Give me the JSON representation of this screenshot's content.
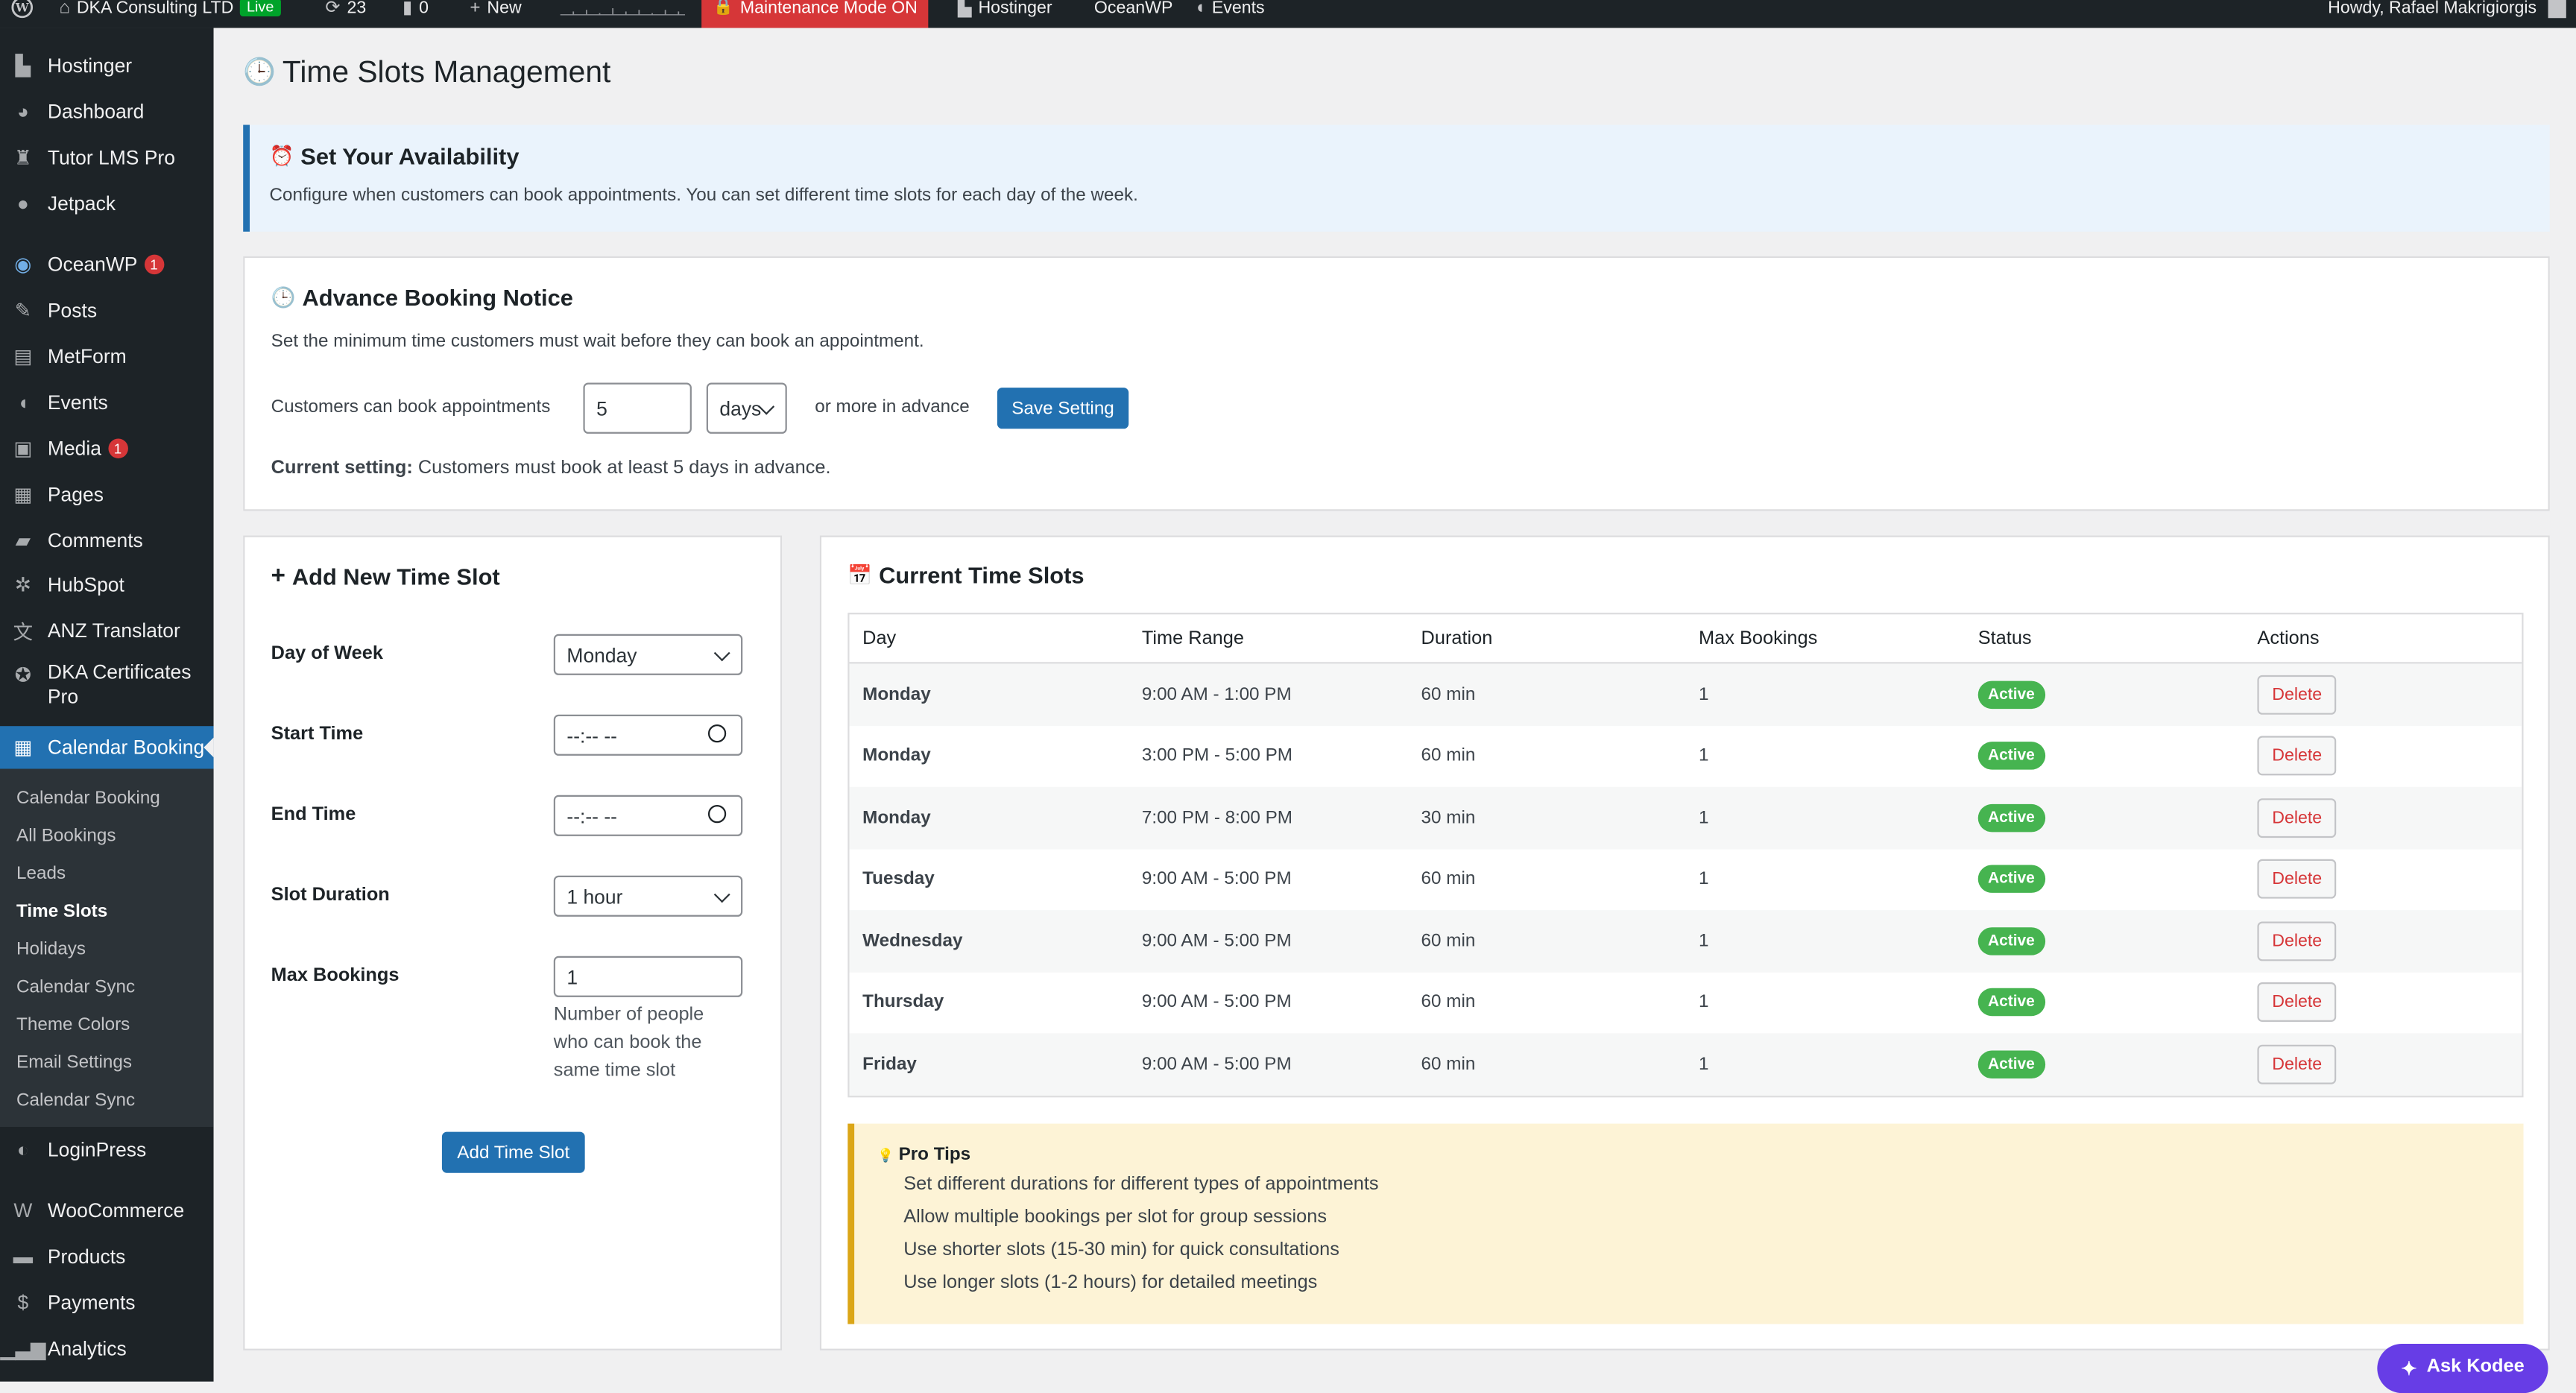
{
  "admin_bar": {
    "site_name": "DKA Consulting LTD",
    "live_badge": "Live",
    "updates_count": "23",
    "comments_count": "0",
    "new_label": "New",
    "maintenance_label": "Maintenance Mode ON",
    "hostinger_label": "Hostinger",
    "oceanwp_label": "OceanWP",
    "events_label": "Events",
    "howdy": "Howdy, Rafael Makrigiorgis"
  },
  "sidebar": {
    "items": [
      {
        "label": "Hostinger",
        "icon": "hostinger-icon"
      },
      {
        "label": "Dashboard",
        "icon": "dashboard-icon"
      },
      {
        "label": "Tutor LMS Pro",
        "icon": "tutor-icon"
      },
      {
        "label": "Jetpack",
        "icon": "jetpack-icon"
      },
      {
        "label": "OceanWP",
        "icon": "oceanwp-icon",
        "badge": "1"
      },
      {
        "label": "Posts",
        "icon": "pin-icon"
      },
      {
        "label": "MetForm",
        "icon": "form-icon"
      },
      {
        "label": "Events",
        "icon": "megaphone-icon"
      },
      {
        "label": "Media",
        "icon": "media-icon",
        "badge": "1"
      },
      {
        "label": "Pages",
        "icon": "pages-icon"
      },
      {
        "label": "Comments",
        "icon": "comment-icon"
      },
      {
        "label": "HubSpot",
        "icon": "hubspot-icon"
      },
      {
        "label": "ANZ Translator",
        "icon": "translate-icon"
      },
      {
        "label": "DKA Certificates Pro",
        "icon": "certificate-icon"
      },
      {
        "label": "Calendar Booking",
        "icon": "calendar-icon"
      },
      {
        "label": "LoginPress",
        "icon": "loginpress-icon"
      },
      {
        "label": "WooCommerce",
        "icon": "woocommerce-icon"
      },
      {
        "label": "Products",
        "icon": "products-icon"
      },
      {
        "label": "Payments",
        "icon": "payments-icon"
      },
      {
        "label": "Analytics",
        "icon": "analytics-icon"
      }
    ],
    "submenu": [
      "Calendar Booking",
      "All Bookings",
      "Leads",
      "Time Slots",
      "Holidays",
      "Calendar Sync",
      "Theme Colors",
      "Email Settings",
      "Calendar Sync"
    ]
  },
  "page": {
    "title": "Time Slots Management"
  },
  "availability": {
    "title": "Set Your Availability",
    "description": "Configure when customers can book appointments. You can set different time slots for each day of the week."
  },
  "advance": {
    "title": "Advance Booking Notice",
    "description": "Set the minimum time customers must wait before they can book an appointment.",
    "label": "Customers can book appointments",
    "value": "5",
    "unit": "days",
    "suffix": "or more in advance",
    "save_label": "Save Setting",
    "current_label": "Current setting:",
    "current_text": "Customers must book at least 5 days in advance."
  },
  "add_slot": {
    "title": "Add New Time Slot",
    "day_label": "Day of Week",
    "day_value": "Monday",
    "start_label": "Start Time",
    "start_value": "--:-- --",
    "end_label": "End Time",
    "end_value": "--:-- --",
    "duration_label": "Slot Duration",
    "duration_value": "1 hour",
    "max_label": "Max Bookings",
    "max_value": "1",
    "max_help": "Number of people who can book the same time slot",
    "submit_label": "Add Time Slot"
  },
  "slots": {
    "title": "Current Time Slots",
    "headers": [
      "Day",
      "Time Range",
      "Duration",
      "Max Bookings",
      "Status",
      "Actions"
    ],
    "rows": [
      {
        "day": "Monday",
        "range": "9:00 AM - 1:00 PM",
        "duration": "60 min",
        "max": "1",
        "status": "Active",
        "action": "Delete"
      },
      {
        "day": "Monday",
        "range": "3:00 PM - 5:00 PM",
        "duration": "60 min",
        "max": "1",
        "status": "Active",
        "action": "Delete"
      },
      {
        "day": "Monday",
        "range": "7:00 PM - 8:00 PM",
        "duration": "30 min",
        "max": "1",
        "status": "Active",
        "action": "Delete"
      },
      {
        "day": "Tuesday",
        "range": "9:00 AM - 5:00 PM",
        "duration": "60 min",
        "max": "1",
        "status": "Active",
        "action": "Delete"
      },
      {
        "day": "Wednesday",
        "range": "9:00 AM - 5:00 PM",
        "duration": "60 min",
        "max": "1",
        "status": "Active",
        "action": "Delete"
      },
      {
        "day": "Thursday",
        "range": "9:00 AM - 5:00 PM",
        "duration": "60 min",
        "max": "1",
        "status": "Active",
        "action": "Delete"
      },
      {
        "day": "Friday",
        "range": "9:00 AM - 5:00 PM",
        "duration": "60 min",
        "max": "1",
        "status": "Active",
        "action": "Delete"
      }
    ]
  },
  "tips": {
    "title": "Pro Tips",
    "items": [
      "Set different durations for different types of appointments",
      "Allow multiple bookings per slot for group sessions",
      "Use shorter slots (15-30 min) for quick consultations",
      "Use longer slots (1-2 hours) for detailed meetings"
    ]
  },
  "kodee": {
    "label": "Ask Kodee"
  },
  "colors": {
    "primary": "#2271b1",
    "admin_bar": "#1d2327",
    "maintenance": "#d63638",
    "active": "#46b450",
    "delete": "#d63638",
    "tips_bg": "#fdf3d6",
    "tips_border": "#dba617",
    "info_bg": "#eaf3fc",
    "kodee": "#673de6"
  }
}
